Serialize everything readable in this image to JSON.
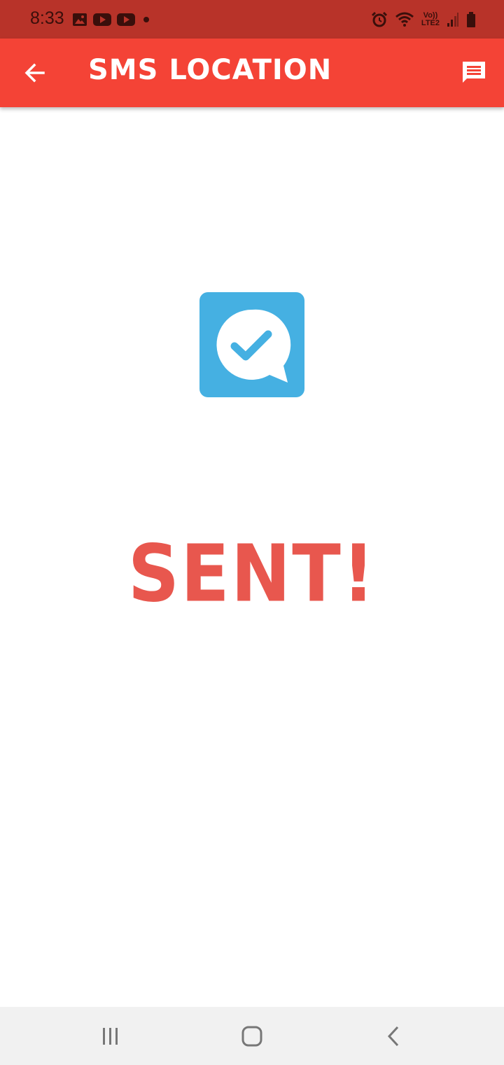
{
  "status_bar": {
    "time": "8:33",
    "left_icons": [
      "image-icon",
      "youtube-icon",
      "youtube-icon",
      "dot-icon"
    ],
    "right_icons": [
      "alarm-icon",
      "wifi-icon",
      "volte-lte2-icon",
      "signal-icon",
      "battery-icon"
    ],
    "lte_top": "Vo))",
    "lte_bottom": "LTE2"
  },
  "app_bar": {
    "title": "SMS LOCATION",
    "background": "#f44336",
    "back_icon": "arrow-back-icon",
    "action_icon": "message-icon"
  },
  "main": {
    "status_icon": "message-sent-check-icon",
    "icon_color": "#45b0e2",
    "status_text": "SENT!",
    "status_text_color": "#e8574e"
  },
  "nav_bar": {
    "buttons": [
      "recent-apps-icon",
      "home-icon",
      "back-icon"
    ]
  }
}
